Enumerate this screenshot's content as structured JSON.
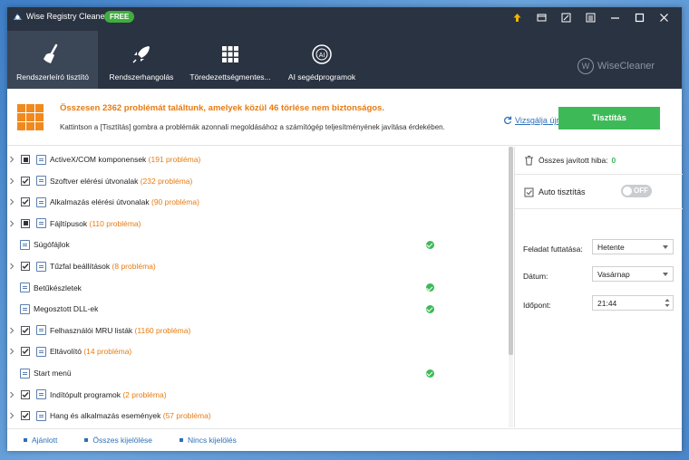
{
  "app": {
    "title": "Wise Registry Cleaner 11",
    "badge": "FREE",
    "brand": "WiseCleaner",
    "brand_logo_letter": "W"
  },
  "window_controls": [
    "upgrade-icon",
    "message-icon",
    "edit-icon",
    "menu-icon",
    "minimize-icon",
    "maximize-icon",
    "close-icon"
  ],
  "nav": [
    {
      "label": "Rendszerleíró tisztító",
      "icon": "broom-icon",
      "active": true
    },
    {
      "label": "Rendszerhangolás",
      "icon": "rocket-icon",
      "active": false
    },
    {
      "label": "Töredezettségmentes...",
      "icon": "grid-icon",
      "active": false
    },
    {
      "label": "AI segédprogramok",
      "icon": "ai-icon",
      "active": false
    }
  ],
  "summary": {
    "title": "Összesen 2362 problémát találtunk, amelyek közül 46 törlése nem biztonságos.",
    "subtitle": "Kattintson a [Tisztítás] gombra a problémák azonnali megoldásához a számítógép teljesítményének javítása érdekében.",
    "rescan_label": "Vizsgálja újra",
    "clean_label": "Tisztítás"
  },
  "items": [
    {
      "label": "ActiveX/COM komponensek",
      "count": "(191 probléma)",
      "check": "partial",
      "expandable": true,
      "ok": false
    },
    {
      "label": "Szoftver elérési útvonalak",
      "count": "(232 probléma)",
      "check": "checked",
      "expandable": true,
      "ok": false
    },
    {
      "label": "Alkalmazás elérési útvonalak",
      "count": "(90 probléma)",
      "check": "checked",
      "expandable": true,
      "ok": false
    },
    {
      "label": "Fájltípusok",
      "count": "(110 probléma)",
      "check": "partial",
      "expandable": true,
      "ok": false
    },
    {
      "label": "Súgófájlok",
      "count": "",
      "check": "none",
      "expandable": false,
      "ok": true
    },
    {
      "label": "Tűzfal beállítások",
      "count": "(8 probléma)",
      "check": "checked",
      "expandable": true,
      "ok": false
    },
    {
      "label": "Betűkészletek",
      "count": "",
      "check": "none",
      "expandable": false,
      "ok": true
    },
    {
      "label": "Megosztott DLL-ek",
      "count": "",
      "check": "none",
      "expandable": false,
      "ok": true
    },
    {
      "label": "Felhasználói MRU listák",
      "count": "(1160 probléma)",
      "check": "checked",
      "expandable": true,
      "ok": false
    },
    {
      "label": "Eltávolító",
      "count": "(14 probléma)",
      "check": "checked",
      "expandable": true,
      "ok": false
    },
    {
      "label": "Start menü",
      "count": "",
      "check": "none",
      "expandable": false,
      "ok": true
    },
    {
      "label": "Indítópult programok",
      "count": "(2 probléma)",
      "check": "checked",
      "expandable": true,
      "ok": false
    },
    {
      "label": "Hang és alkalmazás események",
      "count": "(57 probléma)",
      "check": "checked",
      "expandable": true,
      "ok": false
    }
  ],
  "side": {
    "fixed_label": "Összes javított hiba:",
    "fixed_value": "0",
    "auto_label": "Auto tisztítás",
    "toggle_label": "OFF",
    "task_label": "Feladat futtatása:",
    "task_value": "Hetente",
    "date_label": "Dátum:",
    "date_value": "Vasárnap",
    "time_label": "Időpont:",
    "time_value": "21:44"
  },
  "footer": {
    "recommended": "Ajánlott",
    "select_all": "Összes kijelölése",
    "select_none": "Nincs kijelölés"
  },
  "colors": {
    "header_bg": "#2a3342",
    "accent_orange": "#e77b12",
    "green": "#3dba57",
    "link_blue": "#2e6fb7"
  }
}
